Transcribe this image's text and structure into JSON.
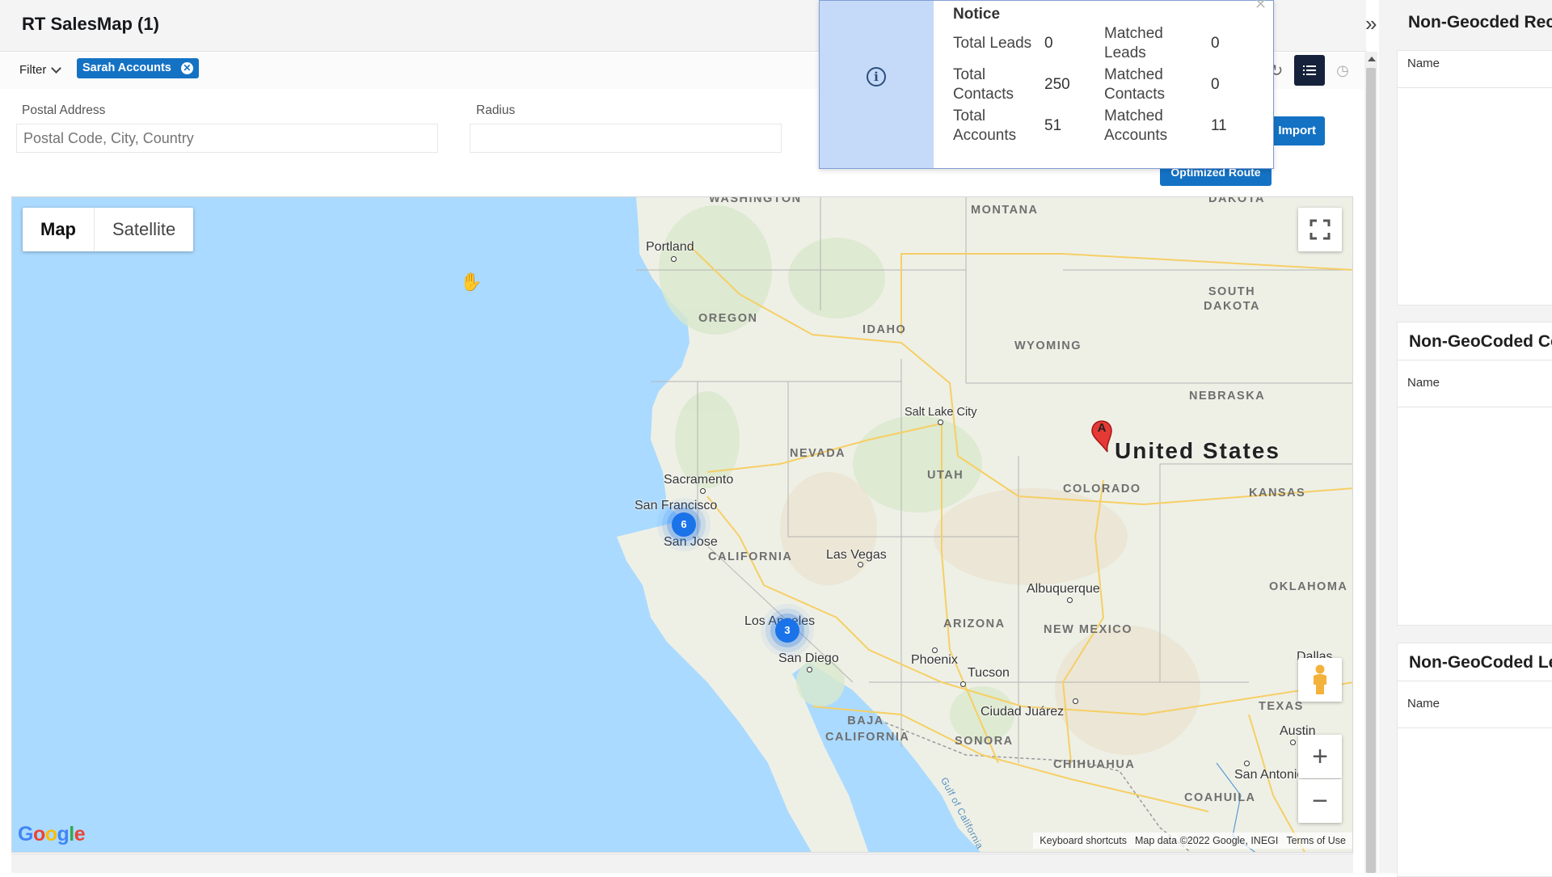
{
  "app": {
    "title": "RT SalesMap (1)"
  },
  "filter": {
    "label": "Filter",
    "chip": "Sarah Accounts"
  },
  "form": {
    "postal_label": "Postal Address",
    "postal_placeholder": "Postal Code, City, Country",
    "radius_label": "Radius"
  },
  "buttons": {
    "import_pins": "Import Pins",
    "optimized_route": "Optimized Route"
  },
  "notice": {
    "title": "Notice",
    "stats": [
      {
        "label": "Total Leads",
        "value": "0",
        "matched_label": "Matched Leads",
        "matched_value": "0"
      },
      {
        "label": "Total Contacts",
        "value": "250",
        "matched_label": "Matched Contacts",
        "matched_value": "0"
      },
      {
        "label": "Total Accounts",
        "value": "51",
        "matched_label": "Matched Accounts",
        "matched_value": "11"
      }
    ]
  },
  "map": {
    "type_buttons": [
      "Map",
      "Satellite"
    ],
    "country": "United States",
    "cities": [
      "Portland",
      "Salt Lake City",
      "Sacramento",
      "San Francisco",
      "San Jose",
      "Las Vegas",
      "Los Angeles",
      "San Diego",
      "Phoenix",
      "Tucson",
      "Albuquerque",
      "Ciudad Juárez",
      "Dallas",
      "Austin",
      "San Antonio"
    ],
    "regions": [
      "WASHINGTON",
      "MONTANA",
      "DAKOTA",
      "SOUTH DAKOTA",
      "OREGON",
      "IDAHO",
      "WYOMING",
      "NEBRASKA",
      "NEVADA",
      "UTAH",
      "COLORADO",
      "KANSAS",
      "CALIFORNIA",
      "ARIZONA",
      "NEW MEXICO",
      "OKLAHOMA",
      "BAJA CALIFORNIA",
      "SONORA",
      "CHIHUAHUA",
      "TEXAS",
      "COAHUILA",
      "Gulf of California"
    ],
    "clusters": [
      {
        "count": "6",
        "near": "San Francisco"
      },
      {
        "count": "3",
        "near": "Los Angeles"
      }
    ],
    "marker_label": "A",
    "zoom_in": "+",
    "zoom_out": "−",
    "logo": "Google",
    "footer": {
      "shortcuts": "Keyboard shortcuts",
      "attribution": "Map data ©2022 Google, INEGI",
      "terms": "Terms of Use"
    }
  },
  "right_panel": {
    "sections": [
      {
        "title": "Non-Geocded Records",
        "column": "Name"
      },
      {
        "title": "Non-GeoCoded Contacts",
        "column": "Name"
      },
      {
        "title": "Non-GeoCoded Leads",
        "column": "Name"
      }
    ]
  },
  "colors": {
    "primary": "#1472c4",
    "cluster": "#1a73e8",
    "water": "#aadaff",
    "land": "#eef0e6",
    "notice_side": "#c4daf8"
  }
}
